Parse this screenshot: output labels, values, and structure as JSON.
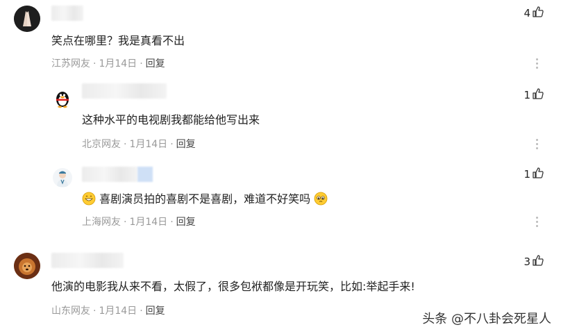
{
  "comments": [
    {
      "text": "笑点在哪里？我是真看不出",
      "location": "江苏网友",
      "date": "1月14日",
      "reply": "回复",
      "likes": "4",
      "avatar_icon": "praying-hands-avatar-icon"
    },
    {
      "text": "这种水平的电视剧我都能给他写出来",
      "location": "北京网友",
      "date": "1月14日",
      "reply": "回复",
      "likes": "1",
      "avatar_icon": "penguin-avatar-icon"
    },
    {
      "text": "喜剧演员拍的喜剧不是喜剧，难道不好笑吗",
      "location": "上海网友",
      "date": "1月14日",
      "reply": "回复",
      "likes": "1",
      "avatar_icon": "doctor-avatar-icon",
      "emoji_left": "grin-emoji-icon",
      "emoji_right": "pleading-emoji-icon"
    },
    {
      "text": "他演的电影我从来不看，太假了，很多包袱都像是开玩笑，比如:举起手来!",
      "location": "山东网友",
      "date": "1月14日",
      "reply": "回复",
      "likes": "3",
      "avatar_icon": "lion-avatar-icon"
    }
  ],
  "watermark": "头条 @不八卦会死星人",
  "separator": "·",
  "colors": {
    "meta": "#999999",
    "text": "#222222",
    "accent_blur": "#cfe0f6"
  }
}
